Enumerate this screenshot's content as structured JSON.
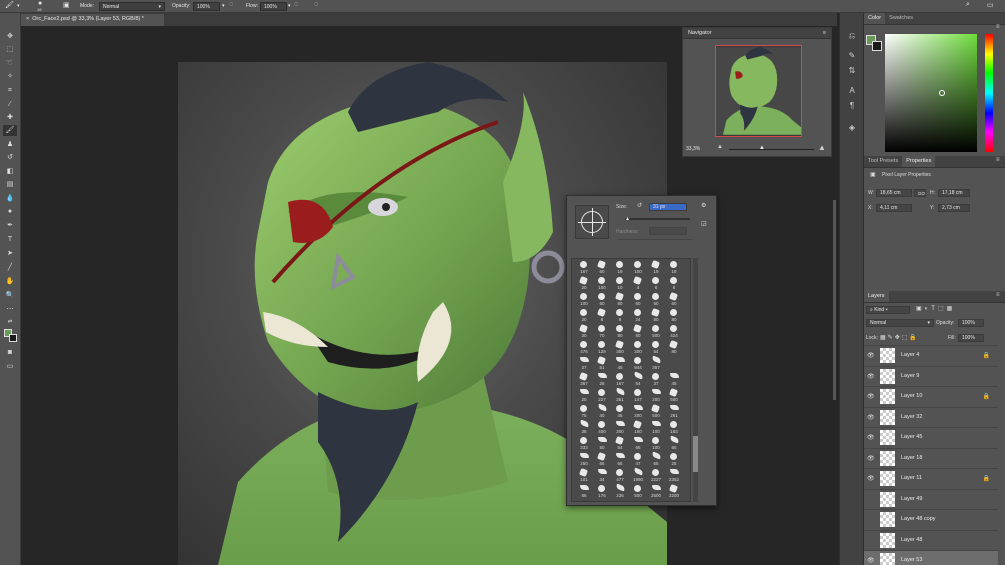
{
  "options_bar": {
    "mode_label": "Mode:",
    "mode_value": "Normal",
    "opacity_label": "Opacity:",
    "opacity_value": "100%",
    "flow_label": "Flow:",
    "flow_value": "100%",
    "brush_size_label": "19"
  },
  "document": {
    "tab_title": "Orc_Face2.psd @ 33,3% (Layer 53, RGB/8) *"
  },
  "navigator": {
    "title": "Navigator",
    "zoom": "33,3%"
  },
  "color_panel": {
    "tabs": [
      "Color",
      "Swatches"
    ],
    "foreground": "#6a9a58",
    "background": "#1a1a1a"
  },
  "properties_panel": {
    "tabs": [
      "Tool Presets",
      "Properties"
    ],
    "header": "Pixel Layer Properties",
    "w_label": "W:",
    "w_value": "18,65 cm",
    "go_label": "GO",
    "h_label": "H:",
    "h_value": "17,18 cm",
    "x_label": "X:",
    "x_value": "4,11 cm",
    "y_label": "Y:",
    "y_value": "2,73 cm"
  },
  "layers_panel": {
    "title": "Layers",
    "kind_label": "Kind",
    "blend_mode": "Normal",
    "opacity_label": "Opacity:",
    "opacity_value": "100%",
    "lock_label": "Lock:",
    "fill_label": "Fill:",
    "fill_value": "100%",
    "layers": [
      {
        "name": "Layer 4",
        "visible": true,
        "locked": true
      },
      {
        "name": "Layer 9",
        "visible": true,
        "locked": false
      },
      {
        "name": "Layer 10",
        "visible": true,
        "locked": true
      },
      {
        "name": "Layer 32",
        "visible": true,
        "locked": false
      },
      {
        "name": "Layer 45",
        "visible": true,
        "locked": false
      },
      {
        "name": "Layer 18",
        "visible": true,
        "locked": false
      },
      {
        "name": "Layer 11",
        "visible": true,
        "locked": true
      },
      {
        "name": "Layer 49",
        "visible": false,
        "locked": false
      },
      {
        "name": "Layer 48 copy",
        "visible": false,
        "locked": false
      },
      {
        "name": "Layer 48",
        "visible": false,
        "locked": false
      },
      {
        "name": "Layer 53",
        "visible": true,
        "locked": false
      }
    ]
  },
  "brush_picker": {
    "size_label": "Size:",
    "size_value": "31 px",
    "hardness_label": "Hardness:",
    "rows": [
      [
        "167",
        "60",
        "19",
        "100",
        "19",
        "19"
      ],
      [
        "20",
        "100",
        "10",
        "4",
        "6",
        "8"
      ],
      [
        "100",
        "60",
        "80",
        "60",
        "60",
        "60"
      ],
      [
        "20",
        "8",
        "8",
        "24",
        "80",
        "80"
      ],
      [
        "30",
        "70",
        "80",
        "60",
        "500",
        "424"
      ],
      [
        "476",
        "129",
        "300",
        "200",
        "54",
        "80"
      ],
      [
        "37",
        "51",
        "45",
        "944",
        "357"
      ],
      [
        "367",
        "26",
        "167",
        "54",
        "37",
        "45"
      ],
      [
        "20",
        "227",
        "251",
        "147",
        "200",
        "500"
      ],
      [
        "75",
        "40",
        "45",
        "200",
        "500",
        "261"
      ],
      [
        "38",
        "400",
        "200",
        "160",
        "100",
        "183"
      ],
      [
        "333",
        "50",
        "54",
        "65",
        "100",
        "65"
      ],
      [
        "250",
        "65",
        "65",
        "47",
        "65",
        "25"
      ],
      [
        "101",
        "34",
        "477",
        "1990",
        "2227",
        "2352"
      ],
      [
        "86",
        "176",
        "236",
        "500",
        "2500",
        "2200"
      ]
    ]
  }
}
